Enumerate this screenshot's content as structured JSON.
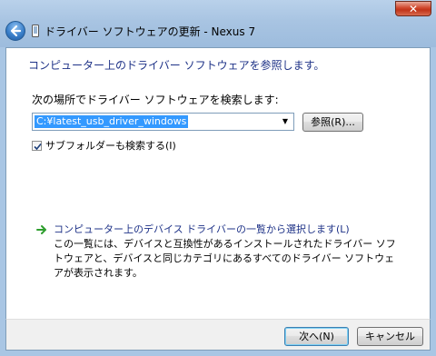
{
  "window": {
    "title": "ドライバー ソフトウェアの更新 - Nexus 7",
    "close_glyph": "✕"
  },
  "content": {
    "heading": "コンピューター上のドライバー ソフトウェアを参照します。",
    "search_label": "次の場所でドライバー ソフトウェアを検索します:",
    "path_value": "C:¥latest_usb_driver_windows",
    "browse_label": "参照(R)...",
    "include_subfolders_label": "サブフォルダーも検索する(I)",
    "include_subfolders_checked": true,
    "pick_link_title": "コンピューター上のデバイス ドライバーの一覧から選択します(L)",
    "pick_link_desc": "この一覧には、デバイスと互換性があるインストールされたドライバー ソフトウェアと、デバイスと同じカテゴリにあるすべてのドライバー ソフトウェアが表示されます。"
  },
  "footer": {
    "next_label": "次へ(N)",
    "cancel_label": "キャンセル"
  },
  "icons": {
    "back": "back-arrow-icon",
    "device": "device-icon",
    "link_arrow": "green-arrow-icon",
    "checkbox": "checkmark-icon",
    "dropdown": "dropdown-arrow-icon"
  },
  "colors": {
    "heading": "#1e3287",
    "selection": "#3399ff",
    "link_arrow": "#2f9e2f",
    "close": "#c1341a"
  }
}
